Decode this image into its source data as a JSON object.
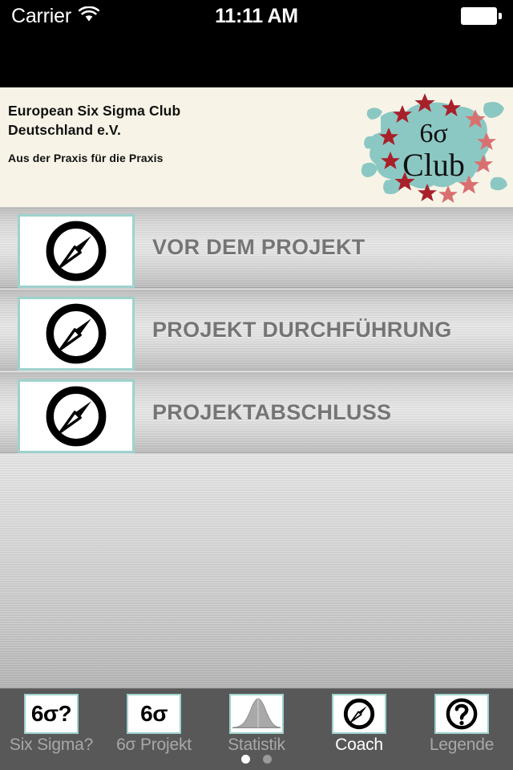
{
  "status_bar": {
    "carrier": "Carrier",
    "wifi_icon": "wifi-icon",
    "time": "11:11 AM",
    "battery_icon": "battery-full-icon"
  },
  "header": {
    "title_line1": "European Six Sigma Club",
    "title_line2": "Deutschland e.V.",
    "subtitle": "Aus der Praxis für die Praxis",
    "logo": {
      "name": "six-sigma-club-europe-logo",
      "text_top": "6σ",
      "text_bottom": "Club",
      "map_color": "#8cc8c3",
      "star_dark": "#a8202a",
      "star_light": "#d97070",
      "background": "#f7f4e7"
    }
  },
  "menu": {
    "rows": [
      {
        "label": "VOR DEM PROJEKT",
        "icon": "compass-icon"
      },
      {
        "label": "PROJEKT DURCHFÜHRUNG",
        "icon": "compass-icon"
      },
      {
        "label": "PROJEKTABSCHLUSS",
        "icon": "compass-icon"
      }
    ],
    "label_color": "#757575",
    "tile_border_color": "#9ed2cd"
  },
  "tab_bar": {
    "background": "#585858",
    "active_label_color": "#ffffff",
    "inactive_label_color": "#a8a8a8",
    "tabs": [
      {
        "label": "Six Sigma?",
        "icon": "six-sigma-question-icon",
        "icon_text": "6σ?",
        "active": false
      },
      {
        "label": "6σ Projekt",
        "icon": "six-sigma-icon",
        "icon_text": "6σ",
        "active": false
      },
      {
        "label": "Statistik",
        "icon": "bell-curve-icon",
        "icon_text": "",
        "active": false
      },
      {
        "label": "Coach",
        "icon": "compass-icon",
        "icon_text": "",
        "active": true
      },
      {
        "label": "Legende",
        "icon": "question-mark-icon",
        "icon_text": "",
        "active": false
      }
    ],
    "page_dots": {
      "count": 2,
      "active_index": 0
    }
  }
}
